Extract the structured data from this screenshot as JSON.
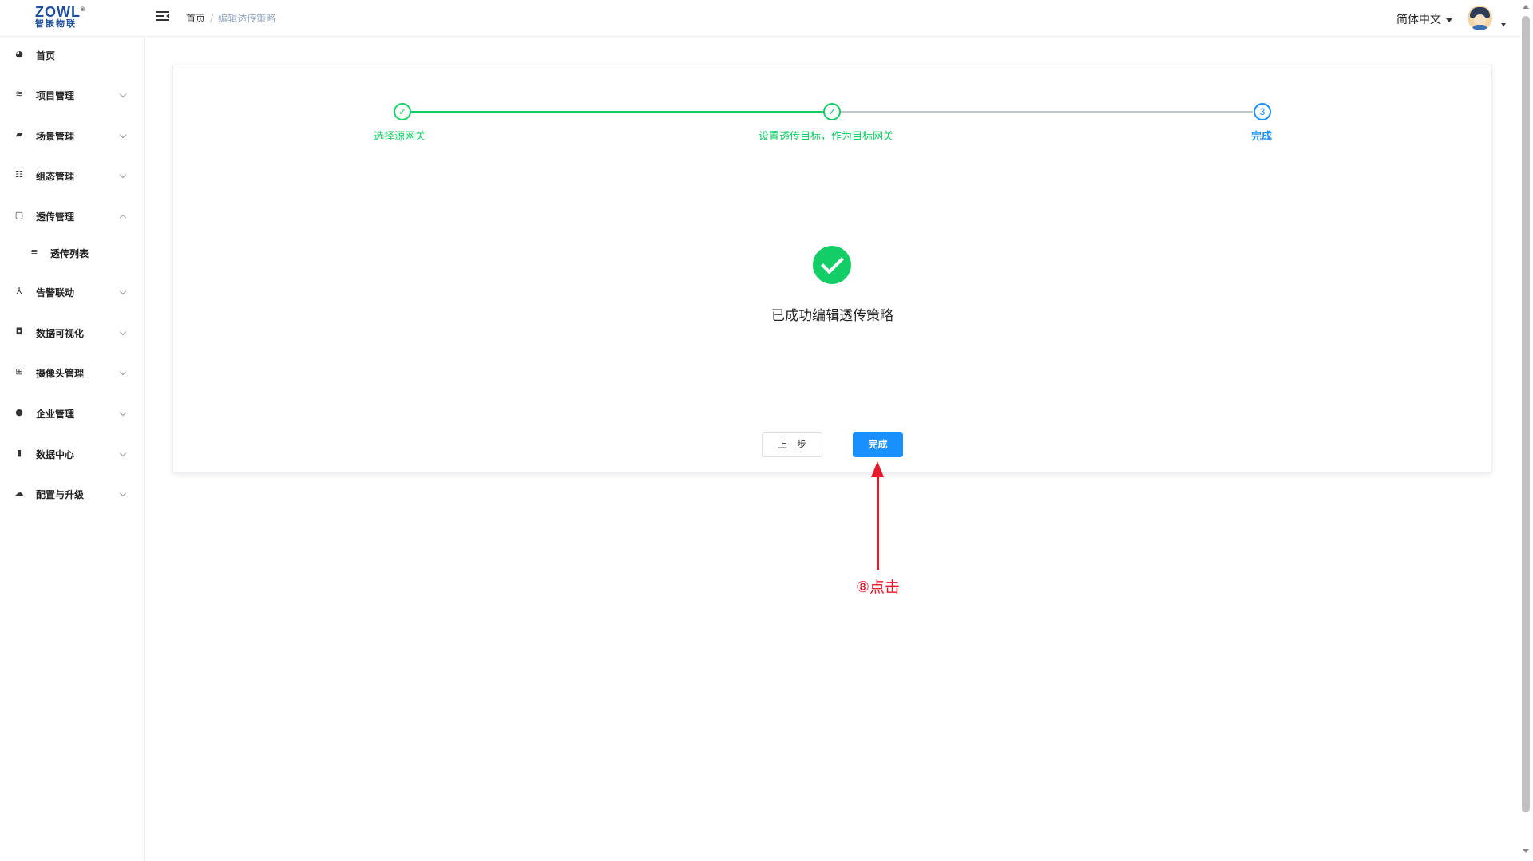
{
  "logo": {
    "brand_main": "ZOWL",
    "brand_mark": "®",
    "brand_sub": "智嵌物联"
  },
  "breadcrumb": {
    "home": "首页",
    "separator": "/",
    "current": "编辑透传策略"
  },
  "header": {
    "language": "简体中文"
  },
  "sidebar": {
    "items": [
      {
        "label": "首页",
        "icon": "dashboard-icon",
        "expandable": false
      },
      {
        "label": "项目管理",
        "icon": "layers-icon",
        "expandable": true
      },
      {
        "label": "场景管理",
        "icon": "clapperboard-icon",
        "expandable": true
      },
      {
        "label": "组态管理",
        "icon": "table-icon",
        "expandable": true
      },
      {
        "label": "透传管理",
        "icon": "monitor-icon",
        "expandable": true,
        "expanded": true
      },
      {
        "label": "透传列表",
        "icon": "list-icon",
        "sub": true
      },
      {
        "label": "告警联动",
        "icon": "nodes-icon",
        "expandable": true
      },
      {
        "label": "数据可视化",
        "icon": "chat-chart-icon",
        "expandable": true
      },
      {
        "label": "摄像头管理",
        "icon": "grid-icon",
        "expandable": true
      },
      {
        "label": "企业管理",
        "icon": "user-group-icon",
        "expandable": true
      },
      {
        "label": "数据中心",
        "icon": "bar-chart-icon",
        "expandable": true
      },
      {
        "label": "配置与升级",
        "icon": "cloud-upload-icon",
        "expandable": true
      }
    ]
  },
  "steps": [
    {
      "title": "选择源网关",
      "status": "done"
    },
    {
      "title": "设置透传目标，作为目标网关",
      "status": "done"
    },
    {
      "title": "完成",
      "status": "active",
      "number": "3"
    }
  ],
  "result": {
    "message": "已成功编辑透传策略"
  },
  "buttons": {
    "prev": "上一步",
    "done": "完成"
  },
  "annotation": {
    "text": "⑧点击",
    "color": "#e8192c"
  },
  "colors": {
    "primary": "#1890ff",
    "success": "#13ce66",
    "annotation": "#e8192c"
  }
}
